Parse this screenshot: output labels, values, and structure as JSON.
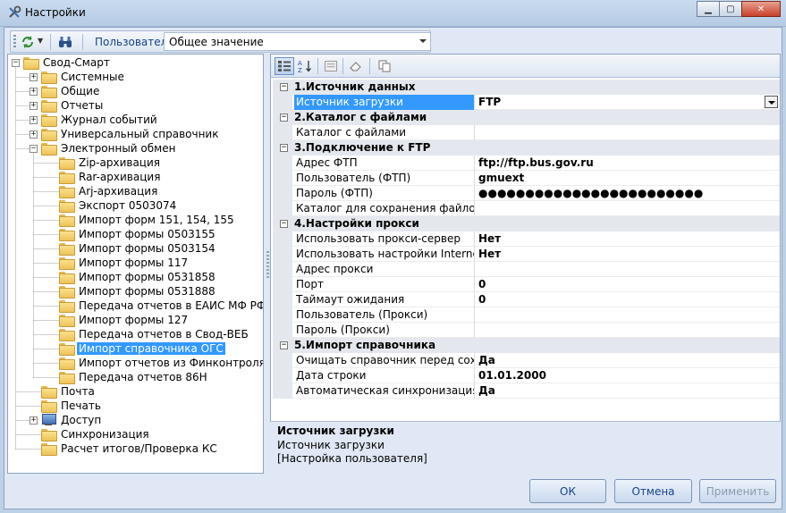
{
  "window": {
    "title": "Настройки"
  },
  "toolbar": {
    "user_label": "Пользователь",
    "user_value": "Общее значение"
  },
  "tree": [
    {
      "label": "Свод-Смарт",
      "level": 0,
      "expander": "−",
      "icon": "folder-icon"
    },
    {
      "label": "Системные",
      "level": 1,
      "expander": "+",
      "icon": "folder-icon"
    },
    {
      "label": "Общие",
      "level": 1,
      "expander": "+",
      "icon": "folder-icon"
    },
    {
      "label": "Отчеты",
      "level": 1,
      "expander": "+",
      "icon": "folder-icon"
    },
    {
      "label": "Журнал событий",
      "level": 1,
      "expander": "+",
      "icon": "folder-icon"
    },
    {
      "label": "Универсальный справочник",
      "level": 1,
      "expander": "+",
      "icon": "folder-icon"
    },
    {
      "label": "Электронный обмен",
      "level": 1,
      "expander": "−",
      "icon": "folder-icon"
    },
    {
      "label": "Zip-архивация",
      "level": 2,
      "expander": "",
      "icon": "folder-icon"
    },
    {
      "label": "Rar-архивация",
      "level": 2,
      "expander": "",
      "icon": "folder-icon"
    },
    {
      "label": "Arj-архивация",
      "level": 2,
      "expander": "",
      "icon": "folder-icon"
    },
    {
      "label": "Экспорт 0503074",
      "level": 2,
      "expander": "",
      "icon": "folder-icon"
    },
    {
      "label": "Импорт форм 151, 154, 155",
      "level": 2,
      "expander": "",
      "icon": "folder-icon"
    },
    {
      "label": "Импорт формы 0503155",
      "level": 2,
      "expander": "",
      "icon": "folder-icon"
    },
    {
      "label": "Импорт формы 0503154",
      "level": 2,
      "expander": "",
      "icon": "folder-icon"
    },
    {
      "label": "Импорт формы 117",
      "level": 2,
      "expander": "",
      "icon": "folder-icon"
    },
    {
      "label": "Импорт формы 0531858",
      "level": 2,
      "expander": "",
      "icon": "folder-icon"
    },
    {
      "label": "Импорт формы 0531888",
      "level": 2,
      "expander": "",
      "icon": "folder-icon"
    },
    {
      "label": "Передача отчетов в ЕАИС МФ РФ",
      "level": 2,
      "expander": "",
      "icon": "folder-icon"
    },
    {
      "label": "Импорт формы 127",
      "level": 2,
      "expander": "",
      "icon": "folder-icon"
    },
    {
      "label": "Передача отчетов в Свод-ВЕБ",
      "level": 2,
      "expander": "",
      "icon": "folder-icon"
    },
    {
      "label": "Импорт справочника ОГС",
      "level": 2,
      "expander": "",
      "icon": "folder-icon",
      "selected": true
    },
    {
      "label": "Импорт отчетов из Финконтроля",
      "level": 2,
      "expander": "",
      "icon": "folder-icon"
    },
    {
      "label": "Передача отчетов 86Н",
      "level": 2,
      "expander": "",
      "icon": "folder-icon"
    },
    {
      "label": "Почта",
      "level": 1,
      "expander": "",
      "icon": "folder-icon"
    },
    {
      "label": "Печать",
      "level": 1,
      "expander": "",
      "icon": "folder-icon"
    },
    {
      "label": "Доступ",
      "level": 1,
      "expander": "+",
      "icon": "computer-icon"
    },
    {
      "label": "Синхронизация",
      "level": 1,
      "expander": "",
      "icon": "folder-icon"
    },
    {
      "label": "Расчет итогов/Проверка КС",
      "level": 1,
      "expander": "",
      "icon": "folder-icon"
    }
  ],
  "grid": [
    {
      "type": "category",
      "label": "1.Источник данных"
    },
    {
      "type": "property",
      "name": "Источник загрузки",
      "value": "FTP",
      "selected": true,
      "dropdown": true
    },
    {
      "type": "category",
      "label": "2.Каталог с файлами"
    },
    {
      "type": "property",
      "name": "Каталог с файлами",
      "value": ""
    },
    {
      "type": "category",
      "label": "3.Подключение к FTP"
    },
    {
      "type": "property",
      "name": "Адрес ФТП",
      "value": "ftp://ftp.bus.gov.ru"
    },
    {
      "type": "property",
      "name": "Пользователь (ФТП)",
      "value": "gmuext"
    },
    {
      "type": "property",
      "name": "Пароль (ФТП)",
      "value": "●●●●●●●●●●●●●●●●●●●●●●●●"
    },
    {
      "type": "property",
      "name": "Каталог для сохранения файлов",
      "value": ""
    },
    {
      "type": "category",
      "label": "4.Настройки прокси"
    },
    {
      "type": "property",
      "name": "Использовать прокси-сервер",
      "value": "Нет"
    },
    {
      "type": "property",
      "name": "Использовать настройки Internet Ex",
      "value": "Нет"
    },
    {
      "type": "property",
      "name": "Адрес прокси",
      "value": ""
    },
    {
      "type": "property",
      "name": "Порт",
      "value": "0"
    },
    {
      "type": "property",
      "name": "Таймаут ожидания",
      "value": "0"
    },
    {
      "type": "property",
      "name": "Пользователь (Прокси)",
      "value": ""
    },
    {
      "type": "property",
      "name": "Пароль (Прокси)",
      "value": ""
    },
    {
      "type": "category",
      "label": "5.Импорт справочника"
    },
    {
      "type": "property",
      "name": "Очищать справочник перед сохран",
      "value": "Да"
    },
    {
      "type": "property",
      "name": "Дата строки",
      "value": "01.01.2000"
    },
    {
      "type": "property",
      "name": "Автоматическая синхронизация со",
      "value": "Да"
    }
  ],
  "description": {
    "title": "Источник загрузки",
    "line1": "Источник загрузки",
    "line2": "[Настройка пользователя]"
  },
  "buttons": {
    "ok": "ОК",
    "cancel": "Отмена",
    "apply": "Применить"
  }
}
